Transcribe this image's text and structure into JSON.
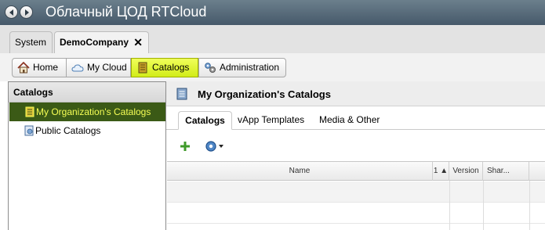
{
  "app": {
    "title": "Облачный ЦОД RTCloud"
  },
  "org_tabs": [
    {
      "label": "System"
    },
    {
      "label": "DemoCompany",
      "close": "✕"
    }
  ],
  "toolbar": {
    "home": "Home",
    "my_cloud": "My Cloud",
    "catalogs": "Catalogs",
    "administration": "Administration"
  },
  "left_panel": {
    "header": "Catalogs",
    "items": [
      {
        "label": "My Organization's Catalogs",
        "selected": true
      },
      {
        "label": "Public Catalogs",
        "selected": false
      }
    ]
  },
  "main": {
    "title": "My Organization's Catalogs",
    "tabs": [
      {
        "label": "Catalogs",
        "active": true
      },
      {
        "label": "vApp Templates",
        "active": false
      },
      {
        "label": "Media & Other",
        "active": false
      }
    ],
    "grid": {
      "columns": {
        "name": "Name",
        "sort": "1 ▲",
        "version": "Version",
        "shared": "Shar..."
      }
    }
  },
  "colors": {
    "accent_highlight": "#d8ef1f",
    "selected_row_bg": "#3b5a16",
    "selected_row_text": "#f6ff55",
    "titlebar": "#566b7a"
  }
}
